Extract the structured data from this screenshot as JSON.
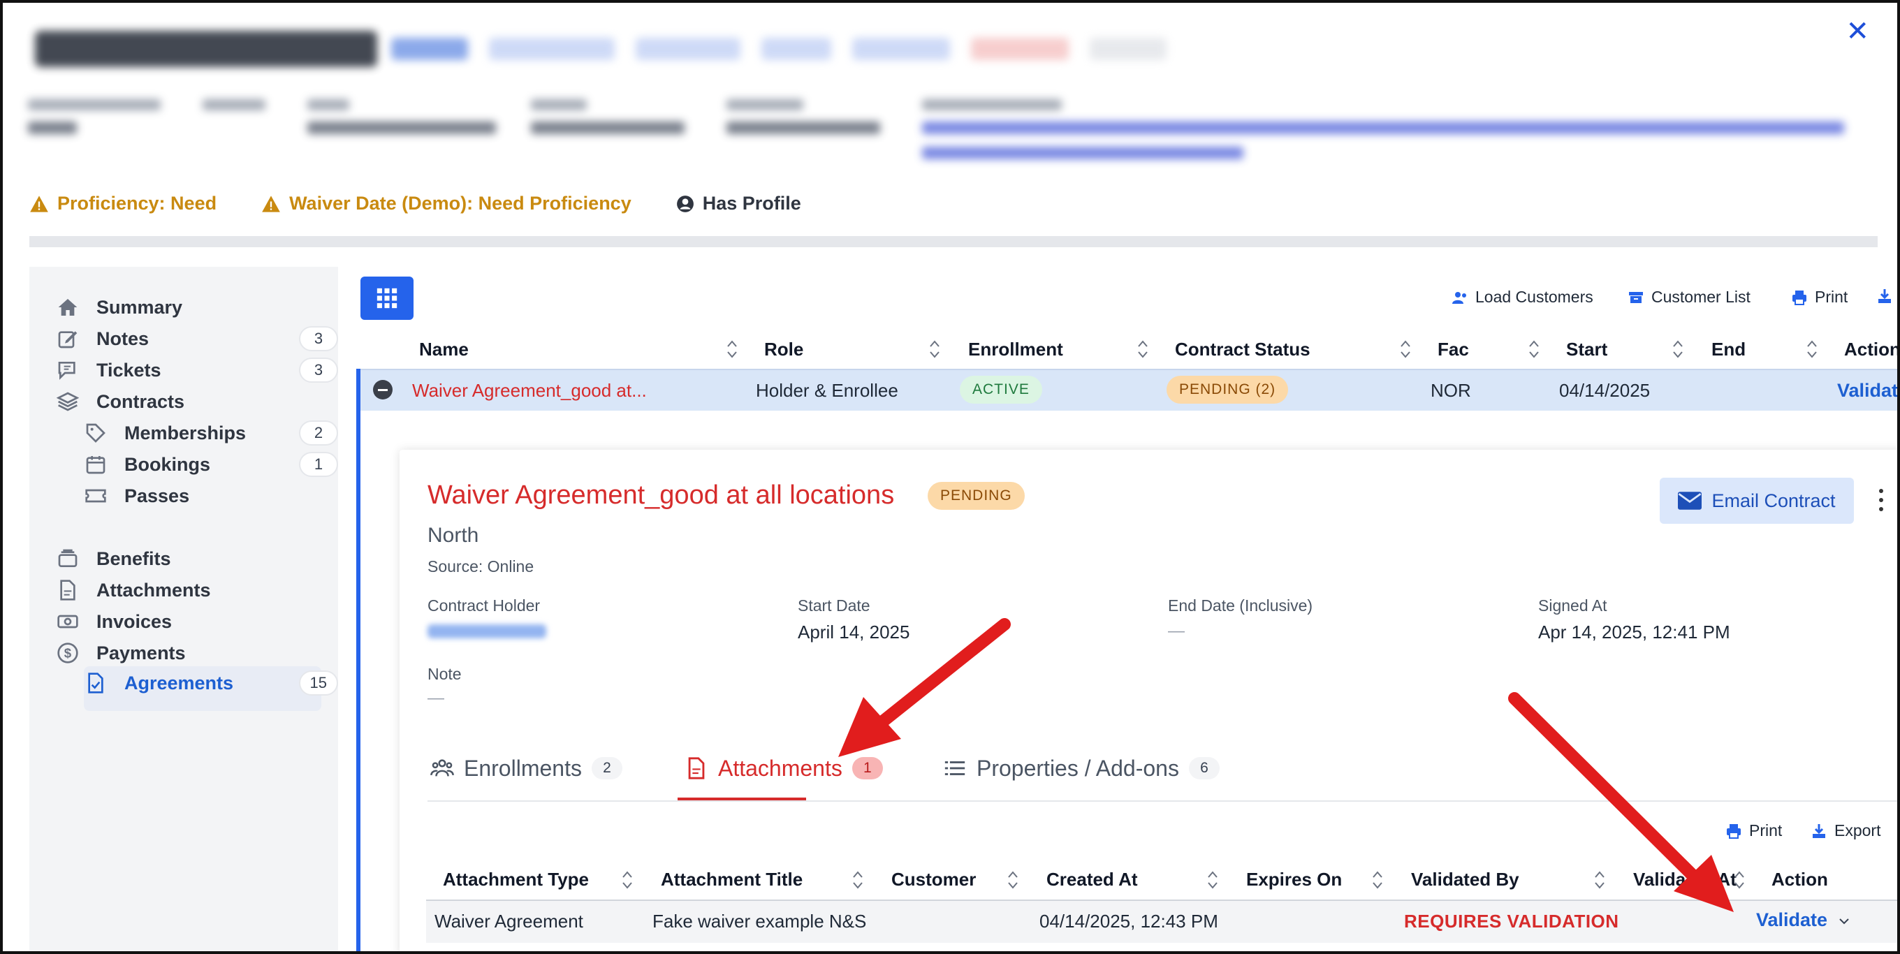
{
  "header": {
    "close_icon": "close-icon",
    "alerts": [
      {
        "icon": "warning-icon",
        "text": "Proficiency: Need",
        "color": "#c98a10"
      },
      {
        "icon": "warning-icon",
        "text": "Waiver Date (Demo): Need Proficiency",
        "color": "#c98a10"
      },
      {
        "icon": "user-circle-icon",
        "text": "Has Profile",
        "color": "#2f3540"
      }
    ]
  },
  "sidebar": {
    "items": [
      {
        "label": "Summary",
        "icon": "home-icon"
      },
      {
        "label": "Notes",
        "icon": "pencil-icon",
        "count": "3"
      },
      {
        "label": "Tickets",
        "icon": "chat-icon",
        "count": "3"
      },
      {
        "label": "Contracts",
        "icon": "layers-icon"
      },
      {
        "label": "Memberships",
        "icon": "tag-icon",
        "count": "2"
      },
      {
        "label": "Bookings",
        "icon": "calendar-icon",
        "count": "1"
      },
      {
        "label": "Passes",
        "icon": "ticket-icon"
      },
      {
        "label": "Agreements",
        "icon": "document-check-icon",
        "count": "15"
      },
      {
        "label": "Benefits",
        "icon": "archive-icon"
      },
      {
        "label": "Attachments",
        "icon": "document-icon"
      },
      {
        "label": "Invoices",
        "icon": "cash-icon"
      },
      {
        "label": "Payments",
        "icon": "dollar-circle-icon"
      }
    ],
    "active": "Agreements"
  },
  "toolbar": {
    "load_customers": "Load Customers",
    "customer_list": "Customer List",
    "print": "Print"
  },
  "table": {
    "columns": [
      "Name",
      "Role",
      "Enrollment",
      "Contract Status",
      "Fac",
      "Start",
      "End",
      "Action"
    ],
    "row": {
      "name": "Waiver Agreement_good at...",
      "role": "Holder & Enrollee",
      "enrollment": "ACTIVE",
      "contract_status": "PENDING (2)",
      "fac": "NOR",
      "start": "04/14/2025",
      "end": "",
      "action": "Validat"
    }
  },
  "detail": {
    "title": "Waiver Agreement_good at all locations",
    "status": "PENDING",
    "location": "North",
    "source": "Source: Online",
    "email_button": "Email Contract",
    "fields": {
      "contract_holder_label": "Contract Holder",
      "start_date_label": "Start Date",
      "start_date": "April 14, 2025",
      "end_date_label": "End Date (Inclusive)",
      "end_date": "—",
      "signed_at_label": "Signed At",
      "signed_at": "Apr 14, 2025, 12:41 PM",
      "note_label": "Note",
      "note": "—"
    },
    "tabs": [
      {
        "label": "Enrollments",
        "count": "2",
        "icon": "users-icon"
      },
      {
        "label": "Attachments",
        "count": "1",
        "icon": "document-icon"
      },
      {
        "label": "Properties / Add-ons",
        "count": "6",
        "icon": "list-icon"
      }
    ],
    "active_tab": "Attachments",
    "sub_toolbar": {
      "print": "Print",
      "export": "Export"
    },
    "attachments": {
      "columns": [
        "Attachment Type",
        "Attachment Title",
        "Customer",
        "Created At",
        "Expires On",
        "Validated By",
        "Validated At",
        "Action"
      ],
      "rows": [
        {
          "type": "Waiver Agreement",
          "title": "Fake waiver example N&S",
          "customer": "",
          "created_at": "04/14/2025, 12:43 PM",
          "expires_on": "",
          "validated_by": "REQUIRES VALIDATION",
          "validated_at": "",
          "action": "Validate"
        }
      ]
    }
  },
  "annotations": {
    "arrow_color": "#e11d1d",
    "count": 2
  }
}
